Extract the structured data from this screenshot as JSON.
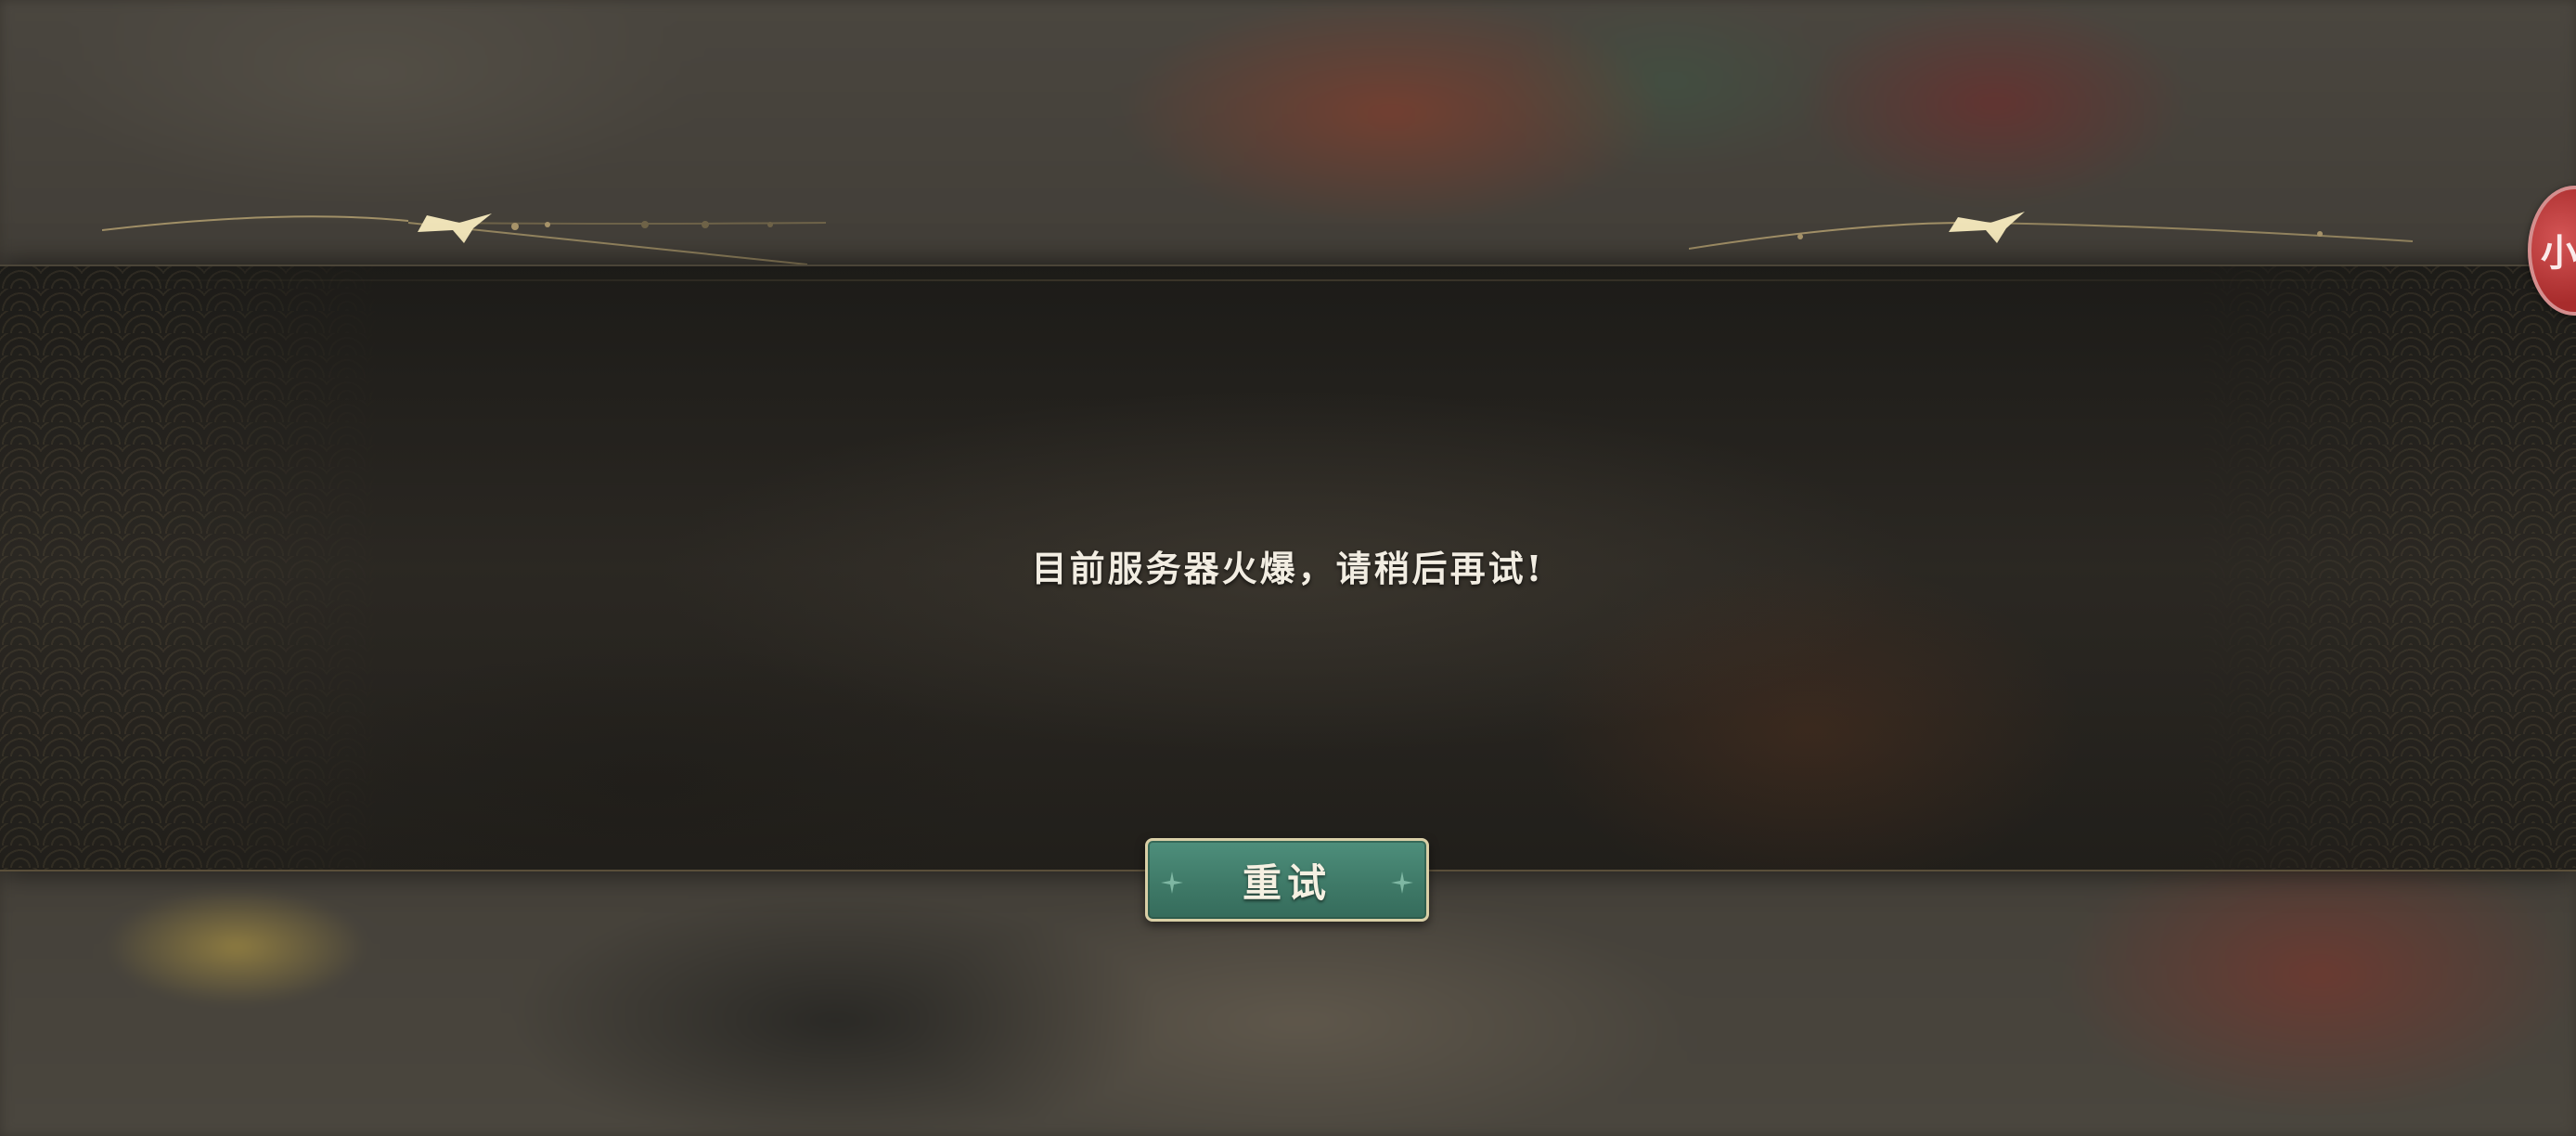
{
  "dialog": {
    "message": "目前服务器火爆，请稍后再试!",
    "retry_label": "重试"
  },
  "side_button": {
    "label": "小"
  },
  "colors": {
    "banner": "#24221e",
    "button_fill": "#3f7a68",
    "button_border": "#d9cfa6",
    "side_button": "#b33a3a",
    "ornament_gold": "#d9c48a"
  }
}
